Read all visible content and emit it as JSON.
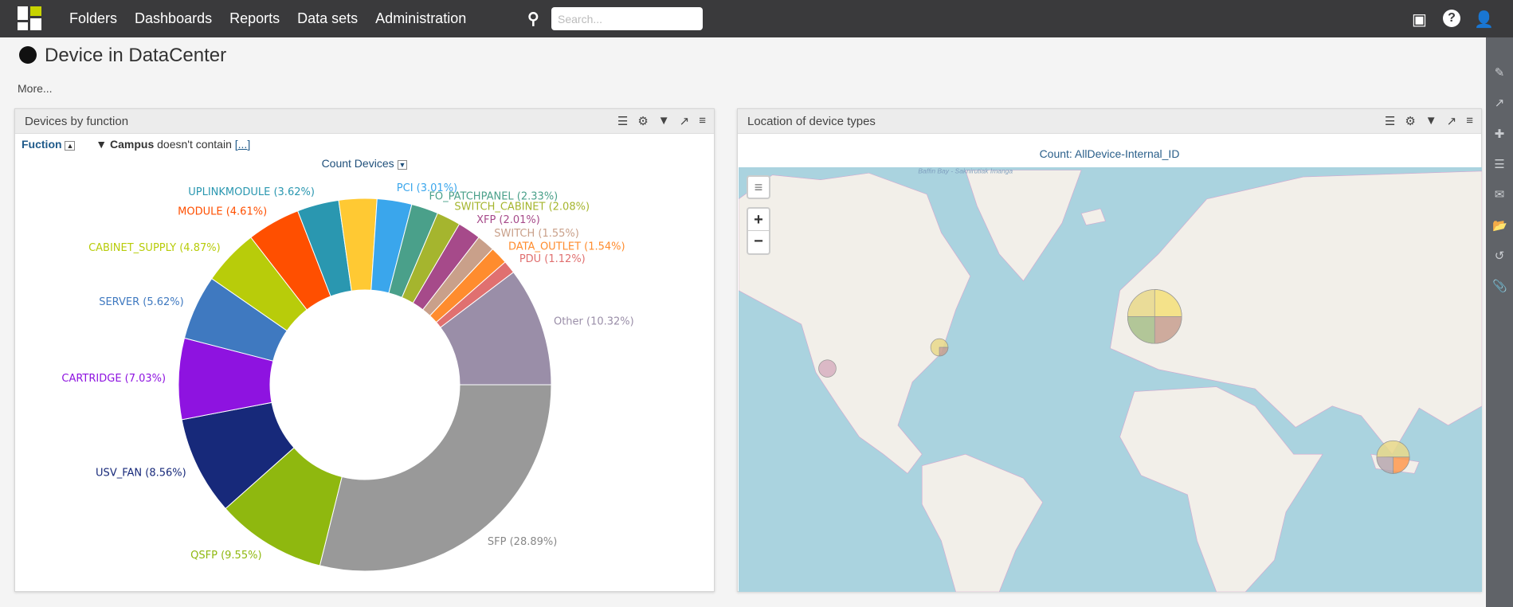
{
  "nav": {
    "items": [
      "Folders",
      "Dashboards",
      "Reports",
      "Data sets",
      "Administration"
    ],
    "search_placeholder": "Search..."
  },
  "page": {
    "title": "Device in DataCenter",
    "more": "More..."
  },
  "left_panel": {
    "title": "Devices by function",
    "filter_field": "Fuction",
    "filter_label": "Campus",
    "filter_op": "doesn't contain",
    "filter_value": "[...]",
    "measure": "Count Devices"
  },
  "right_panel": {
    "title": "Location of device types",
    "measure": "Count: AllDevice-Internal_ID",
    "map_label": "Baffin Bay - Saknirutiak Imanga"
  },
  "chart_data": {
    "type": "pie",
    "donut": true,
    "slices": [
      {
        "name": "SFP",
        "value": 28.89,
        "label": "SFP (28.89%)",
        "color": "#999999"
      },
      {
        "name": "QSFP",
        "value": 9.55,
        "label": "QSFP (9.55%)",
        "color": "#8fb80f"
      },
      {
        "name": "USV_FAN",
        "value": 8.56,
        "label": "USV_FAN (8.56%)",
        "color": "#17297a"
      },
      {
        "name": "CARTRIDGE",
        "value": 7.03,
        "label": "CARTRIDGE (7.03%)",
        "color": "#8e13e0"
      },
      {
        "name": "SERVER",
        "value": 5.62,
        "label": "SERVER (5.62%)",
        "color": "#3f79c0"
      },
      {
        "name": "CABINET_SUPPLY",
        "value": 4.87,
        "label": "CABINET_SUPPLY (4.87%)",
        "color": "#b8cc0a"
      },
      {
        "name": "MODULE",
        "value": 4.61,
        "label": "MODULE (4.61%)",
        "color": "#ff4f00"
      },
      {
        "name": "UPLINKMODULE",
        "value": 3.62,
        "label": "UPLINKMODULE (3.62%)",
        "color": "#2a97b0"
      },
      {
        "name": "",
        "value": 3.29,
        "label": "",
        "color": "#ffc933"
      },
      {
        "name": "PCI",
        "value": 3.01,
        "label": "PCI (3.01%)",
        "color": "#3aa6ec"
      },
      {
        "name": "FO_PATCHPANEL",
        "value": 2.33,
        "label": "FO_PATCHPANEL (2.33%)",
        "color": "#4aa08a"
      },
      {
        "name": "SWITCH_CABINET",
        "value": 2.08,
        "label": "SWITCH_CABINET (2.08%)",
        "color": "#a5b52e"
      },
      {
        "name": "XFP",
        "value": 2.01,
        "label": "XFP (2.01%)",
        "color": "#a64a8a"
      },
      {
        "name": "SWITCH",
        "value": 1.55,
        "label": "SWITCH (1.55%)",
        "color": "#c9a08a"
      },
      {
        "name": "DATA_OUTLET",
        "value": 1.54,
        "label": "DATA_OUTLET (1.54%)",
        "color": "#ff8c2e"
      },
      {
        "name": "PDU",
        "value": 1.12,
        "label": "PDU (1.12%)",
        "color": "#e07070"
      },
      {
        "name": "Other",
        "value": 10.32,
        "label": "Other (10.32%)",
        "color": "#9a8ea8"
      }
    ]
  }
}
